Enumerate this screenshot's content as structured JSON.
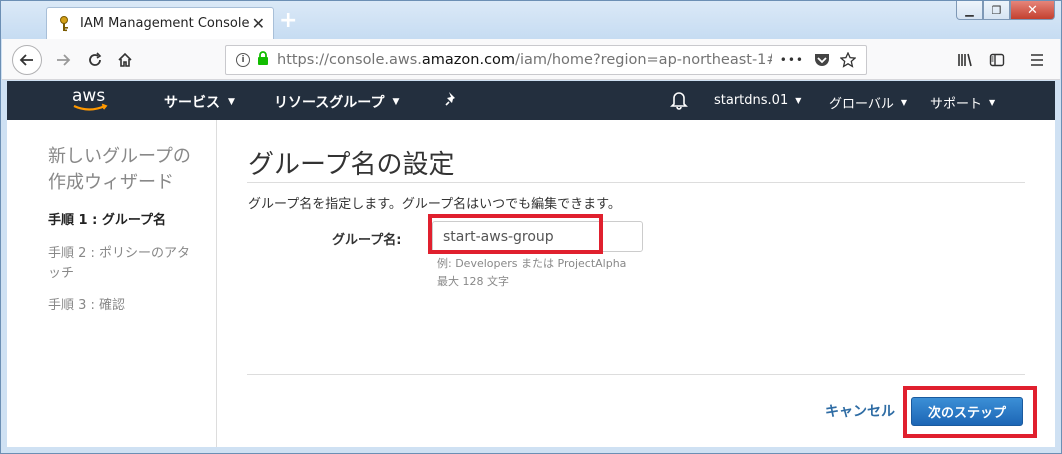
{
  "browser": {
    "tab_title": "IAM Management Console",
    "tab_close": "✕",
    "new_tab": "+",
    "url_prefix": "https://console.aws.",
    "url_domain": "amazon.com",
    "url_path": "/iam/home?region=ap-northeast-1#",
    "url_more": "•••"
  },
  "aws_nav": {
    "logo_text": "aws",
    "services": "サービス",
    "resource_groups": "リソースグループ",
    "account": "startdns.01",
    "region": "グローバル",
    "support": "サポート"
  },
  "sidebar": {
    "title": "新しいグループの作成ウィザード",
    "steps": [
      {
        "label": "手順 1 : グループ名",
        "active": true
      },
      {
        "label": "手順 2 : ポリシーのアタッチ",
        "active": false
      },
      {
        "label": "手順 3 : 確認",
        "active": false
      }
    ]
  },
  "main": {
    "title": "グループ名の設定",
    "description": "グループ名を指定します。グループ名はいつでも編集できます。",
    "field_label": "グループ名:",
    "field_value": "start-aws-group",
    "hint_example": "例: Developers または ProjectAlpha",
    "hint_max": "最大 128 文字",
    "cancel_label": "キャンセル",
    "next_label": "次のステップ"
  },
  "colors": {
    "aws_header": "#232f3e",
    "aws_orange": "#ff9900",
    "primary_button": "#1d66b5",
    "highlight_red": "#e0202e",
    "link": "#2e6ca4"
  }
}
